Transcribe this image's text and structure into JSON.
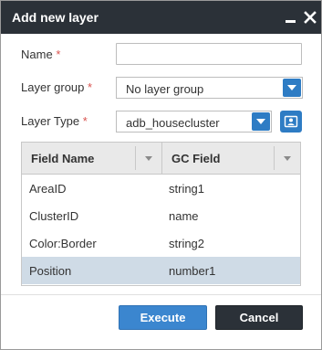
{
  "dialog": {
    "title": "Add new layer",
    "minimize_icon": "minimize-icon",
    "close_icon": "close-icon"
  },
  "form": {
    "name": {
      "label": "Name",
      "required_mark": "*",
      "value": ""
    },
    "layer_group": {
      "label": "Layer group",
      "required_mark": "*",
      "value": "No layer group"
    },
    "layer_type": {
      "label": "Layer Type",
      "required_mark": "*",
      "value": "adb_housecluster"
    }
  },
  "grid": {
    "columns": [
      "Field Name",
      "GC Field"
    ],
    "rows": [
      {
        "field_name": "AreaID",
        "gc_field": "string1"
      },
      {
        "field_name": "ClusterID",
        "gc_field": "name"
      },
      {
        "field_name": "Color:Border",
        "gc_field": "string2"
      },
      {
        "field_name": "Position",
        "gc_field": "number1"
      }
    ],
    "selected_row": 3
  },
  "buttons": {
    "execute": "Execute",
    "cancel": "Cancel"
  },
  "colors": {
    "titlebar": "#2b3138",
    "accent": "#2e7cc4",
    "selected_row": "#cfdbe6",
    "required": "#d9534f"
  }
}
